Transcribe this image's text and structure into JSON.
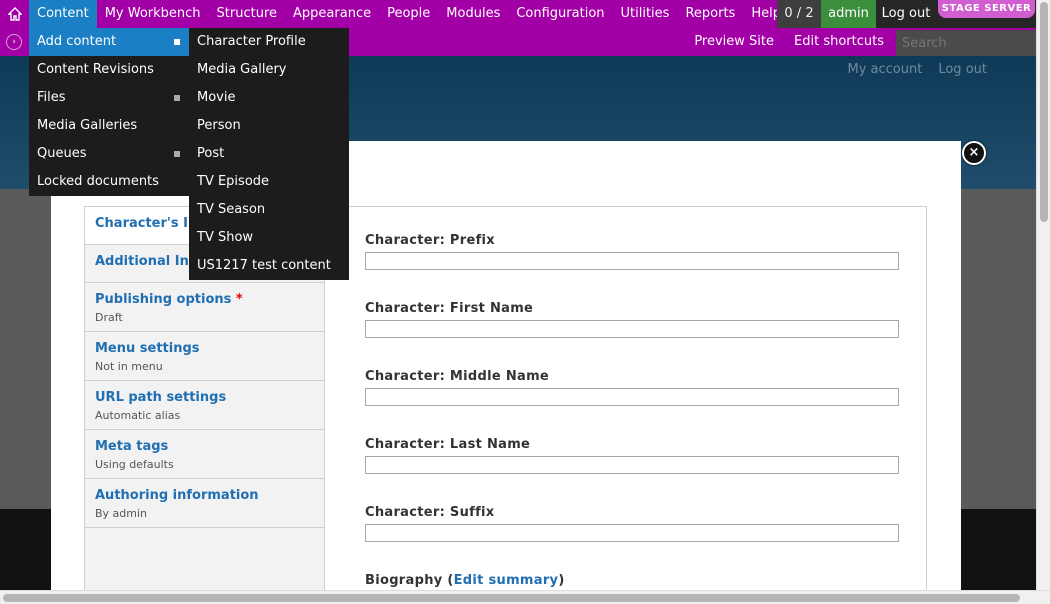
{
  "toolbar": {
    "home_icon": "home-icon",
    "menu": [
      {
        "label": "Content",
        "active": true
      },
      {
        "label": "My Workbench"
      },
      {
        "label": "Structure"
      },
      {
        "label": "Appearance"
      },
      {
        "label": "People"
      },
      {
        "label": "Modules"
      },
      {
        "label": "Configuration"
      },
      {
        "label": "Utilities"
      },
      {
        "label": "Reports"
      },
      {
        "label": "Help"
      }
    ],
    "counter": "0 / 2",
    "user": "admin",
    "logout": "Log out",
    "environment_badge": "STAGE SERVER"
  },
  "shortcuts": {
    "toggle_icon": "circle-chevron-icon",
    "links": [
      "Preview Site",
      "Edit shortcuts"
    ],
    "search_placeholder": "Search"
  },
  "header": {
    "links": [
      "My account",
      "Log out"
    ]
  },
  "content_menu": {
    "items": [
      {
        "label": "Add content",
        "active": true,
        "has_children": true
      },
      {
        "label": "Content Revisions",
        "has_children": false
      },
      {
        "label": "Files",
        "has_children": true
      },
      {
        "label": "Media Galleries",
        "has_children": false
      },
      {
        "label": "Queues",
        "has_children": true
      },
      {
        "label": "Locked documents",
        "has_children": false
      }
    ]
  },
  "add_content_menu": {
    "items": [
      "Character Profile",
      "Media Gallery",
      "Movie",
      "Person",
      "Post",
      "TV Episode",
      "TV Season",
      "TV Show",
      "US1217 test content"
    ]
  },
  "modal": {
    "close_icon": "close-icon",
    "tabs": [
      {
        "title": "Character's Information",
        "summary": ""
      },
      {
        "title": "Additional Information",
        "summary": ""
      },
      {
        "title": "Publishing options",
        "required": "*",
        "summary": "Draft"
      },
      {
        "title": "Menu settings",
        "summary": "Not in menu"
      },
      {
        "title": "URL path settings",
        "summary": "Automatic alias"
      },
      {
        "title": "Meta tags",
        "summary": "Using defaults"
      },
      {
        "title": "Authoring information",
        "summary": "By admin"
      }
    ],
    "fields": [
      {
        "label": "Character: Prefix",
        "value": ""
      },
      {
        "label": "Character: First Name",
        "value": ""
      },
      {
        "label": "Character: Middle Name",
        "value": ""
      },
      {
        "label": "Character: Last Name",
        "value": ""
      },
      {
        "label": "Character: Suffix",
        "value": ""
      }
    ],
    "biography": {
      "label": "Biography",
      "open_paren": "(",
      "link": "Edit summary",
      "close_paren": ")"
    }
  },
  "colors": {
    "toolbar": "#a200a6",
    "active_item": "#1a7fc4",
    "user_badge": "#3b8e3b",
    "environment_badge": "#d05ed0",
    "link": "#1f6fb2"
  }
}
